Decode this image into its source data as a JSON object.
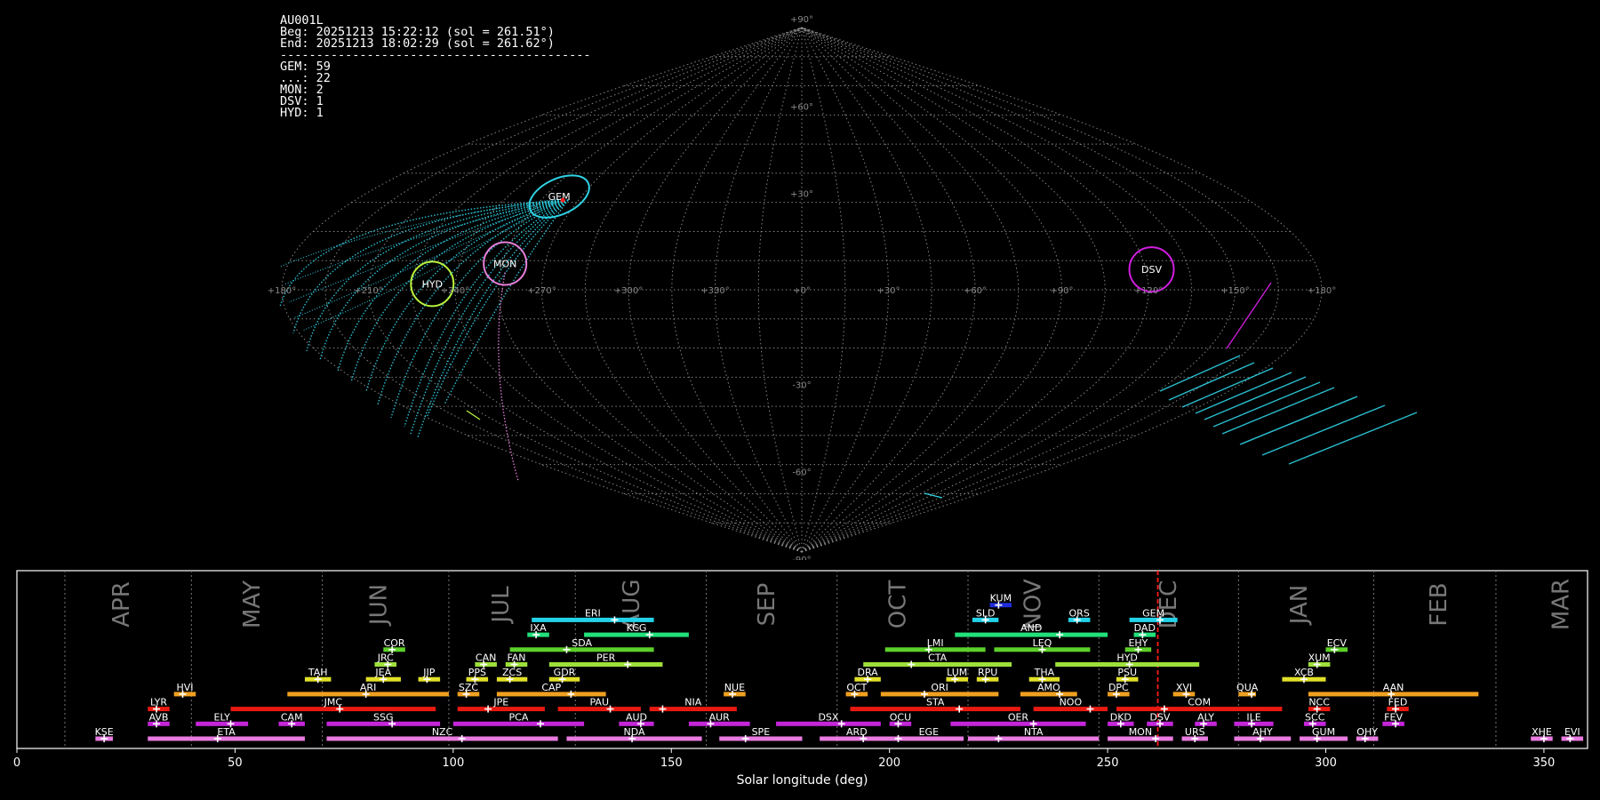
{
  "summary": {
    "station": "AU001L",
    "beg": "Beg: 20251213 15:22:12 (sol = 261.51°)",
    "end": "End: 20251213 18:02:29 (sol = 261.62°)",
    "separator": "-------------------------------------------",
    "counts": [
      "GEM: 59",
      "...: 22",
      "MON: 2",
      "DSV: 1",
      "HYD: 1"
    ]
  },
  "sky_map": {
    "projection": "sinusoidal",
    "lat_labels": [
      "+90°",
      "+60°",
      "+30°",
      "0°",
      "-30°",
      "-60°",
      "-90°"
    ],
    "lon_labels": [
      "+180°",
      "+150°",
      "+120°",
      "+90°",
      "+60°",
      "+30°",
      "+0°",
      "+330°",
      "+300°",
      "+270°",
      "+240°",
      "+210°",
      "+180°"
    ],
    "radiants": [
      {
        "code": "GEM",
        "lon": 99,
        "lat": 32,
        "color": "#2fd3e6"
      },
      {
        "code": "MON",
        "lon": 104,
        "lat": 9,
        "color": "#e57fd8"
      },
      {
        "code": "HYD",
        "lon": 128,
        "lat": 2,
        "color": "#b9f23c"
      },
      {
        "code": "DSV",
        "lon": 238,
        "lat": 7,
        "color": "#d11ee0"
      }
    ],
    "colors": {
      "grid": "#9a9a9a",
      "gem": "#2fd3e6",
      "mon": "#e57fd8",
      "dsv": "#d11ee0",
      "hyd": "#b9f23c"
    }
  },
  "chart_data": {
    "type": "timeline",
    "xlabel": "Solar longitude (deg)",
    "xlim": [
      0,
      360
    ],
    "xticks": [
      0,
      50,
      100,
      150,
      200,
      250,
      300,
      350
    ],
    "current_sol": 261.5,
    "month_boundaries": [
      11,
      40,
      70,
      99,
      128,
      158,
      188,
      218,
      248,
      280,
      311,
      339
    ],
    "months": [
      {
        "name": "APR",
        "center": 24
      },
      {
        "name": "MAY",
        "center": 54
      },
      {
        "name": "JUN",
        "center": 83
      },
      {
        "name": "JUL",
        "center": 111
      },
      {
        "name": "AUG",
        "center": 141
      },
      {
        "name": "SEP",
        "center": 172
      },
      {
        "name": "OCT",
        "center": 202
      },
      {
        "name": "NOV",
        "center": 233
      },
      {
        "name": "DEC",
        "center": 264
      },
      {
        "name": "JAN",
        "center": 294
      },
      {
        "name": "FEB",
        "center": 326
      },
      {
        "name": "MAR",
        "center": 354
      }
    ],
    "showers": [
      {
        "code": "KUM",
        "start": 223,
        "end": 228,
        "peak": 225,
        "row": 9,
        "color": "#1f2cd8"
      },
      {
        "code": "ERI",
        "start": 118,
        "end": 146,
        "peak": 137,
        "row": 8,
        "color": "#23d2e8"
      },
      {
        "code": "SLD",
        "start": 219,
        "end": 225,
        "peak": 222,
        "row": 8,
        "color": "#23d2e8"
      },
      {
        "code": "ORS",
        "start": 241,
        "end": 246,
        "peak": 243,
        "row": 8,
        "color": "#23d2e8"
      },
      {
        "code": "GEM",
        "start": 255,
        "end": 266,
        "peak": 262,
        "row": 8,
        "color": "#23d2e8"
      },
      {
        "code": "IXA",
        "start": 117,
        "end": 122,
        "peak": 119,
        "row": 7,
        "color": "#22e07a"
      },
      {
        "code": "KCG",
        "start": 130,
        "end": 154,
        "peak": 145,
        "row": 7,
        "color": "#22e07a"
      },
      {
        "code": "AND",
        "start": 215,
        "end": 250,
        "peak": 239,
        "row": 7,
        "color": "#22e07a"
      },
      {
        "code": "DAD",
        "start": 256,
        "end": 261,
        "peak": 258,
        "row": 7,
        "color": "#22e07a"
      },
      {
        "code": "COR",
        "start": 84,
        "end": 89,
        "peak": 86,
        "row": 6,
        "color": "#5dd12a"
      },
      {
        "code": "SDA",
        "start": 113,
        "end": 146,
        "peak": 126,
        "row": 6,
        "color": "#5dd12a"
      },
      {
        "code": "LMI",
        "start": 199,
        "end": 222,
        "peak": 209,
        "row": 6,
        "color": "#5dd12a"
      },
      {
        "code": "LEQ",
        "start": 224,
        "end": 246,
        "peak": 235,
        "row": 6,
        "color": "#5dd12a"
      },
      {
        "code": "EHY",
        "start": 254,
        "end": 260,
        "peak": 257,
        "row": 6,
        "color": "#5dd12a"
      },
      {
        "code": "ECV",
        "start": 300,
        "end": 305,
        "peak": 302,
        "row": 6,
        "color": "#5dd12a"
      },
      {
        "code": "JRC",
        "start": 82,
        "end": 87,
        "peak": 85,
        "row": 5,
        "color": "#9ee03a"
      },
      {
        "code": "CAN",
        "start": 105,
        "end": 110,
        "peak": 107,
        "row": 5,
        "color": "#9ee03a"
      },
      {
        "code": "FAN",
        "start": 112,
        "end": 117,
        "peak": 114,
        "row": 5,
        "color": "#9ee03a"
      },
      {
        "code": "PER",
        "start": 122,
        "end": 148,
        "peak": 140,
        "row": 5,
        "color": "#9ee03a"
      },
      {
        "code": "CTA",
        "start": 194,
        "end": 228,
        "peak": 205,
        "row": 5,
        "color": "#9ee03a"
      },
      {
        "code": "HYD",
        "start": 238,
        "end": 271,
        "peak": 255,
        "row": 5,
        "color": "#9ee03a"
      },
      {
        "code": "XUM",
        "start": 296,
        "end": 301,
        "peak": 298,
        "row": 5,
        "color": "#9ee03a"
      },
      {
        "code": "TAH",
        "start": 66,
        "end": 72,
        "peak": 69,
        "row": 4,
        "color": "#e0e02a"
      },
      {
        "code": "JEA",
        "start": 80,
        "end": 88,
        "peak": 84,
        "row": 4,
        "color": "#e0e02a"
      },
      {
        "code": "JIP",
        "start": 92,
        "end": 97,
        "peak": 94,
        "row": 4,
        "color": "#e0e02a"
      },
      {
        "code": "PPS",
        "start": 103,
        "end": 108,
        "peak": 105,
        "row": 4,
        "color": "#e0e02a"
      },
      {
        "code": "ZCS",
        "start": 110,
        "end": 117,
        "peak": 113,
        "row": 4,
        "color": "#e0e02a"
      },
      {
        "code": "GDR",
        "start": 122,
        "end": 129,
        "peak": 125,
        "row": 4,
        "color": "#e0e02a"
      },
      {
        "code": "DRA",
        "start": 192,
        "end": 198,
        "peak": 195,
        "row": 4,
        "color": "#e0e02a"
      },
      {
        "code": "LUM",
        "start": 213,
        "end": 218,
        "peak": 215,
        "row": 4,
        "color": "#e0e02a"
      },
      {
        "code": "RPU",
        "start": 220,
        "end": 225,
        "peak": 222,
        "row": 4,
        "color": "#e0e02a"
      },
      {
        "code": "THA",
        "start": 232,
        "end": 239,
        "peak": 235,
        "row": 4,
        "color": "#e0e02a"
      },
      {
        "code": "PSU",
        "start": 252,
        "end": 257,
        "peak": 254,
        "row": 4,
        "color": "#e0e02a"
      },
      {
        "code": "XCB",
        "start": 290,
        "end": 300,
        "peak": 295,
        "row": 4,
        "color": "#e0e02a"
      },
      {
        "code": "HVI",
        "start": 36,
        "end": 41,
        "peak": 38,
        "row": 3,
        "color": "#f0a020"
      },
      {
        "code": "ARI",
        "start": 62,
        "end": 99,
        "peak": 80,
        "row": 3,
        "color": "#f0a020"
      },
      {
        "code": "SZC",
        "start": 101,
        "end": 106,
        "peak": 103,
        "row": 3,
        "color": "#f0a020"
      },
      {
        "code": "CAP",
        "start": 110,
        "end": 135,
        "peak": 127,
        "row": 3,
        "color": "#f0a020"
      },
      {
        "code": "NUE",
        "start": 162,
        "end": 167,
        "peak": 164,
        "row": 3,
        "color": "#f0a020"
      },
      {
        "code": "OCT",
        "start": 190,
        "end": 195,
        "peak": 192,
        "row": 3,
        "color": "#f0a020"
      },
      {
        "code": "ORI",
        "start": 198,
        "end": 225,
        "peak": 208,
        "row": 3,
        "color": "#f0a020"
      },
      {
        "code": "AMO",
        "start": 230,
        "end": 243,
        "peak": 239,
        "row": 3,
        "color": "#f0a020"
      },
      {
        "code": "DPC",
        "start": 250,
        "end": 255,
        "peak": 252,
        "row": 3,
        "color": "#f0a020"
      },
      {
        "code": "XVI",
        "start": 265,
        "end": 270,
        "peak": 268,
        "row": 3,
        "color": "#f0a020"
      },
      {
        "code": "QUA",
        "start": 280,
        "end": 284,
        "peak": 283,
        "row": 3,
        "color": "#f0a020"
      },
      {
        "code": "AAN",
        "start": 296,
        "end": 335,
        "peak": 315,
        "row": 3,
        "color": "#f0a020"
      },
      {
        "code": "LYR",
        "start": 30,
        "end": 35,
        "peak": 32,
        "row": 2,
        "color": "#e81a12"
      },
      {
        "code": "JMC",
        "start": 49,
        "end": 96,
        "peak": 74,
        "row": 2,
        "color": "#e81a12"
      },
      {
        "code": "JPE",
        "start": 101,
        "end": 121,
        "peak": 108,
        "row": 2,
        "color": "#e81a12"
      },
      {
        "code": "PAU",
        "start": 124,
        "end": 143,
        "peak": 136,
        "row": 2,
        "color": "#e81a12"
      },
      {
        "code": "NIA",
        "start": 145,
        "end": 165,
        "peak": 148,
        "row": 2,
        "color": "#e81a12"
      },
      {
        "code": "STA",
        "start": 191,
        "end": 230,
        "peak": 216,
        "row": 2,
        "color": "#e81a12"
      },
      {
        "code": "NOO",
        "start": 233,
        "end": 250,
        "peak": 246,
        "row": 2,
        "color": "#e81a12"
      },
      {
        "code": "COM",
        "start": 252,
        "end": 290,
        "peak": 263,
        "row": 2,
        "color": "#e81a12"
      },
      {
        "code": "NCC",
        "start": 296,
        "end": 301,
        "peak": 298,
        "row": 2,
        "color": "#e81a12"
      },
      {
        "code": "FED",
        "start": 314,
        "end": 319,
        "peak": 316,
        "row": 2,
        "color": "#e81a12"
      },
      {
        "code": "AVB",
        "start": 30,
        "end": 35,
        "peak": 32,
        "row": 1,
        "color": "#c326d8"
      },
      {
        "code": "ELY",
        "start": 41,
        "end": 53,
        "peak": 49,
        "row": 1,
        "color": "#c326d8"
      },
      {
        "code": "CAM",
        "start": 60,
        "end": 66,
        "peak": 63,
        "row": 1,
        "color": "#c326d8"
      },
      {
        "code": "SSG",
        "start": 71,
        "end": 97,
        "peak": 86,
        "row": 1,
        "color": "#c326d8"
      },
      {
        "code": "PCA",
        "start": 100,
        "end": 130,
        "peak": 120,
        "row": 1,
        "color": "#c326d8"
      },
      {
        "code": "AUD",
        "start": 138,
        "end": 146,
        "peak": 143,
        "row": 1,
        "color": "#c326d8"
      },
      {
        "code": "AUR",
        "start": 154,
        "end": 168,
        "peak": 159,
        "row": 1,
        "color": "#c326d8"
      },
      {
        "code": "DSX",
        "start": 174,
        "end": 198,
        "peak": 189,
        "row": 1,
        "color": "#c326d8"
      },
      {
        "code": "OCU",
        "start": 200,
        "end": 205,
        "peak": 202,
        "row": 1,
        "color": "#c326d8"
      },
      {
        "code": "OER",
        "start": 214,
        "end": 245,
        "peak": 233,
        "row": 1,
        "color": "#c326d8"
      },
      {
        "code": "DKD",
        "start": 250,
        "end": 256,
        "peak": 253,
        "row": 1,
        "color": "#c326d8"
      },
      {
        "code": "DSV",
        "start": 259,
        "end": 265,
        "peak": 262,
        "row": 1,
        "color": "#c326d8"
      },
      {
        "code": "ALY",
        "start": 270,
        "end": 275,
        "peak": 272,
        "row": 1,
        "color": "#c326d8"
      },
      {
        "code": "ILE",
        "start": 279,
        "end": 288,
        "peak": 283,
        "row": 1,
        "color": "#c326d8"
      },
      {
        "code": "SCC",
        "start": 295,
        "end": 300,
        "peak": 297,
        "row": 1,
        "color": "#c326d8"
      },
      {
        "code": "FEV",
        "start": 313,
        "end": 318,
        "peak": 316,
        "row": 1,
        "color": "#c326d8"
      },
      {
        "code": "KSE",
        "start": 18,
        "end": 22,
        "peak": 20,
        "row": 0,
        "color": "#e87be0"
      },
      {
        "code": "ETA",
        "start": 30,
        "end": 66,
        "peak": 46,
        "row": 0,
        "color": "#e87be0"
      },
      {
        "code": "NZC",
        "start": 71,
        "end": 124,
        "peak": 102,
        "row": 0,
        "color": "#e87be0"
      },
      {
        "code": "NDA",
        "start": 126,
        "end": 157,
        "peak": 141,
        "row": 0,
        "color": "#e87be0"
      },
      {
        "code": "SPE",
        "start": 161,
        "end": 180,
        "peak": 167,
        "row": 0,
        "color": "#e87be0"
      },
      {
        "code": "ARD",
        "start": 184,
        "end": 201,
        "peak": 194,
        "row": 0,
        "color": "#e87be0"
      },
      {
        "code": "EGE",
        "start": 201,
        "end": 217,
        "peak": 202,
        "row": 0,
        "color": "#e87be0"
      },
      {
        "code": "NTA",
        "start": 218,
        "end": 248,
        "peak": 225,
        "row": 0,
        "color": "#e87be0"
      },
      {
        "code": "MON",
        "start": 250,
        "end": 265,
        "peak": 261,
        "row": 0,
        "color": "#e87be0"
      },
      {
        "code": "URS",
        "start": 267,
        "end": 273,
        "peak": 270,
        "row": 0,
        "color": "#e87be0"
      },
      {
        "code": "AHY",
        "start": 279,
        "end": 292,
        "peak": 285,
        "row": 0,
        "color": "#e87be0"
      },
      {
        "code": "GUM",
        "start": 294,
        "end": 305,
        "peak": 298,
        "row": 0,
        "color": "#e87be0"
      },
      {
        "code": "OHY",
        "start": 307,
        "end": 312,
        "peak": 309,
        "row": 0,
        "color": "#e87be0"
      },
      {
        "code": "XHE",
        "start": 347,
        "end": 352,
        "peak": 350,
        "row": 0,
        "color": "#e87be0"
      },
      {
        "code": "EVI",
        "start": 354,
        "end": 359,
        "peak": 356,
        "row": 0,
        "color": "#e87be0"
      }
    ]
  }
}
